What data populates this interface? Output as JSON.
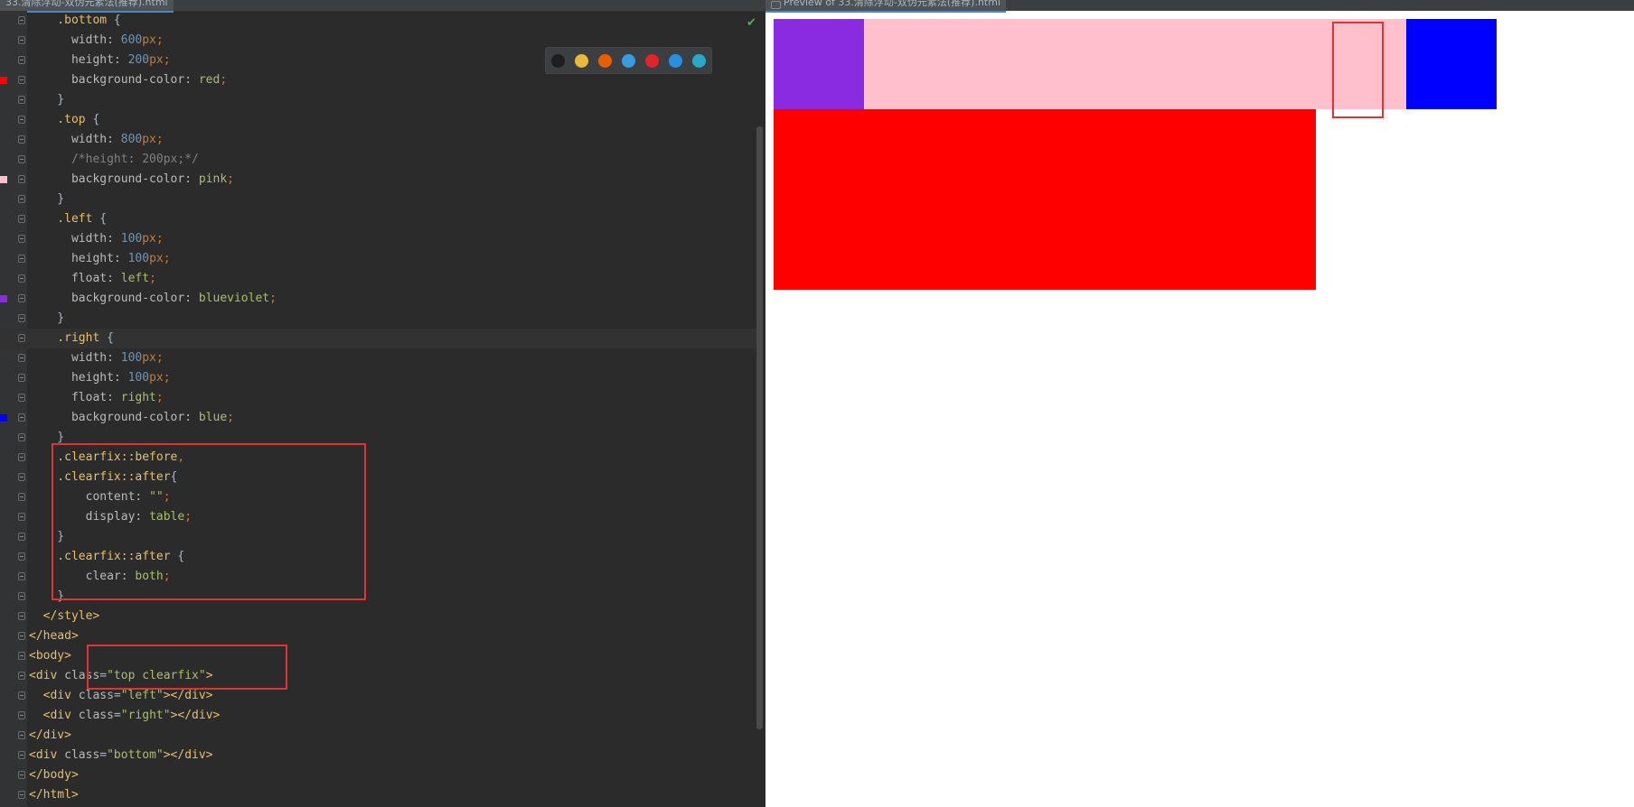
{
  "editor": {
    "tab_label": "33.清除浮动-双伪元素法(推荐).html",
    "lines": [
      {
        "gutter_swatch": null,
        "tokens": [
          {
            "c": "t-sel",
            "t": "    .bottom "
          },
          {
            "c": "",
            "t": "{"
          }
        ]
      },
      {
        "gutter_swatch": null,
        "tokens": [
          {
            "c": "t-prop",
            "t": "      width"
          },
          {
            "c": "",
            "t": ": "
          },
          {
            "c": "t-num",
            "t": "600"
          },
          {
            "c": "t-unit",
            "t": "px"
          },
          {
            "c": "t-punc",
            "t": ";"
          }
        ]
      },
      {
        "gutter_swatch": null,
        "tokens": [
          {
            "c": "t-prop",
            "t": "      height"
          },
          {
            "c": "",
            "t": ": "
          },
          {
            "c": "t-num",
            "t": "200"
          },
          {
            "c": "t-unit",
            "t": "px"
          },
          {
            "c": "t-punc",
            "t": ";"
          }
        ]
      },
      {
        "gutter_swatch": "#ff0000",
        "tokens": [
          {
            "c": "t-prop",
            "t": "      background-color"
          },
          {
            "c": "",
            "t": ": "
          },
          {
            "c": "t-val",
            "t": "red"
          },
          {
            "c": "t-punc",
            "t": ";"
          }
        ]
      },
      {
        "gutter_swatch": null,
        "tokens": [
          {
            "c": "",
            "t": "    }"
          }
        ]
      },
      {
        "gutter_swatch": null,
        "tokens": [
          {
            "c": "t-sel",
            "t": "    .top "
          },
          {
            "c": "",
            "t": "{"
          }
        ]
      },
      {
        "gutter_swatch": null,
        "tokens": [
          {
            "c": "t-prop",
            "t": "      width"
          },
          {
            "c": "",
            "t": ": "
          },
          {
            "c": "t-num",
            "t": "800"
          },
          {
            "c": "t-unit",
            "t": "px"
          },
          {
            "c": "t-punc",
            "t": ";"
          }
        ]
      },
      {
        "gutter_swatch": null,
        "tokens": [
          {
            "c": "t-cmt",
            "t": "      /*height: 200px;*/"
          }
        ]
      },
      {
        "gutter_swatch": "#ffc0cb",
        "tokens": [
          {
            "c": "t-prop",
            "t": "      background-color"
          },
          {
            "c": "",
            "t": ": "
          },
          {
            "c": "t-val",
            "t": "pink"
          },
          {
            "c": "t-punc",
            "t": ";"
          }
        ]
      },
      {
        "gutter_swatch": null,
        "tokens": [
          {
            "c": "",
            "t": "    }"
          }
        ]
      },
      {
        "gutter_swatch": null,
        "tokens": [
          {
            "c": "t-sel",
            "t": "    .left "
          },
          {
            "c": "",
            "t": "{"
          }
        ]
      },
      {
        "gutter_swatch": null,
        "tokens": [
          {
            "c": "t-prop",
            "t": "      width"
          },
          {
            "c": "",
            "t": ": "
          },
          {
            "c": "t-num",
            "t": "100"
          },
          {
            "c": "t-unit",
            "t": "px"
          },
          {
            "c": "t-punc",
            "t": ";"
          }
        ]
      },
      {
        "gutter_swatch": null,
        "tokens": [
          {
            "c": "t-prop",
            "t": "      height"
          },
          {
            "c": "",
            "t": ": "
          },
          {
            "c": "t-num",
            "t": "100"
          },
          {
            "c": "t-unit",
            "t": "px"
          },
          {
            "c": "t-punc",
            "t": ";"
          }
        ]
      },
      {
        "gutter_swatch": null,
        "tokens": [
          {
            "c": "t-prop",
            "t": "      float"
          },
          {
            "c": "",
            "t": ": "
          },
          {
            "c": "t-val",
            "t": "left"
          },
          {
            "c": "t-punc",
            "t": ";"
          }
        ]
      },
      {
        "gutter_swatch": "#8a2be2",
        "tokens": [
          {
            "c": "t-prop",
            "t": "      background-color"
          },
          {
            "c": "",
            "t": ": "
          },
          {
            "c": "t-val",
            "t": "blueviolet"
          },
          {
            "c": "t-punc",
            "t": ";"
          }
        ]
      },
      {
        "gutter_swatch": null,
        "tokens": [
          {
            "c": "",
            "t": "    }"
          }
        ]
      },
      {
        "gutter_swatch": null,
        "caret": true,
        "tokens": [
          {
            "c": "t-sel",
            "t": "    .right "
          },
          {
            "c": "",
            "t": "{"
          }
        ]
      },
      {
        "gutter_swatch": null,
        "tokens": [
          {
            "c": "t-prop",
            "t": "      width"
          },
          {
            "c": "",
            "t": ": "
          },
          {
            "c": "t-num",
            "t": "100"
          },
          {
            "c": "t-unit",
            "t": "px"
          },
          {
            "c": "t-punc",
            "t": ";"
          }
        ]
      },
      {
        "gutter_swatch": null,
        "tokens": [
          {
            "c": "t-prop",
            "t": "      height"
          },
          {
            "c": "",
            "t": ": "
          },
          {
            "c": "t-num",
            "t": "100"
          },
          {
            "c": "t-unit",
            "t": "px"
          },
          {
            "c": "t-punc",
            "t": ";"
          }
        ]
      },
      {
        "gutter_swatch": null,
        "tokens": [
          {
            "c": "t-prop",
            "t": "      float"
          },
          {
            "c": "",
            "t": ": "
          },
          {
            "c": "t-val",
            "t": "right"
          },
          {
            "c": "t-punc",
            "t": ";"
          }
        ]
      },
      {
        "gutter_swatch": "#0000ff",
        "tokens": [
          {
            "c": "t-prop",
            "t": "      background-color"
          },
          {
            "c": "",
            "t": ": "
          },
          {
            "c": "t-val",
            "t": "blue"
          },
          {
            "c": "t-punc",
            "t": ";"
          }
        ]
      },
      {
        "gutter_swatch": null,
        "tokens": [
          {
            "c": "",
            "t": "    }"
          }
        ]
      },
      {
        "gutter_swatch": null,
        "tokens": [
          {
            "c": "t-sel",
            "t": "    .clearfix::before"
          },
          {
            "c": "t-punc",
            "t": ","
          }
        ]
      },
      {
        "gutter_swatch": null,
        "tokens": [
          {
            "c": "t-sel",
            "t": "    .clearfix::after"
          },
          {
            "c": "",
            "t": "{"
          }
        ]
      },
      {
        "gutter_swatch": null,
        "tokens": [
          {
            "c": "t-prop",
            "t": "        content"
          },
          {
            "c": "",
            "t": ": "
          },
          {
            "c": "t-str",
            "t": "\"\""
          },
          {
            "c": "t-punc",
            "t": ";"
          }
        ]
      },
      {
        "gutter_swatch": null,
        "tokens": [
          {
            "c": "t-prop",
            "t": "        display"
          },
          {
            "c": "",
            "t": ": "
          },
          {
            "c": "t-val",
            "t": "table"
          },
          {
            "c": "t-punc",
            "t": ";"
          }
        ]
      },
      {
        "gutter_swatch": null,
        "tokens": [
          {
            "c": "",
            "t": "    }"
          }
        ]
      },
      {
        "gutter_swatch": null,
        "tokens": [
          {
            "c": "t-sel",
            "t": "    .clearfix::after "
          },
          {
            "c": "",
            "t": "{"
          }
        ]
      },
      {
        "gutter_swatch": null,
        "tokens": [
          {
            "c": "t-prop",
            "t": "        clear"
          },
          {
            "c": "",
            "t": ": "
          },
          {
            "c": "t-val",
            "t": "both"
          },
          {
            "c": "t-punc",
            "t": ";"
          }
        ]
      },
      {
        "gutter_swatch": null,
        "tokens": [
          {
            "c": "",
            "t": "    }"
          }
        ]
      },
      {
        "gutter_swatch": null,
        "tokens": [
          {
            "c": "t-tag",
            "t": "  </style>"
          }
        ]
      },
      {
        "gutter_swatch": null,
        "tokens": [
          {
            "c": "t-tag",
            "t": "</head>"
          }
        ]
      },
      {
        "gutter_swatch": null,
        "tokens": [
          {
            "c": "t-tag",
            "t": "<body>"
          }
        ]
      },
      {
        "gutter_swatch": null,
        "tokens": [
          {
            "c": "t-tag",
            "t": "<div "
          },
          {
            "c": "t-attr",
            "t": "class"
          },
          {
            "c": "",
            "t": "="
          },
          {
            "c": "t-str",
            "t": "\"top clearfix\""
          },
          {
            "c": "t-tag",
            "t": ">"
          }
        ]
      },
      {
        "gutter_swatch": null,
        "tokens": [
          {
            "c": "t-tag",
            "t": "  <div "
          },
          {
            "c": "t-attr",
            "t": "class"
          },
          {
            "c": "",
            "t": "="
          },
          {
            "c": "t-str",
            "t": "\"left\""
          },
          {
            "c": "t-tag",
            "t": "></div>"
          }
        ]
      },
      {
        "gutter_swatch": null,
        "tokens": [
          {
            "c": "t-tag",
            "t": "  <div "
          },
          {
            "c": "t-attr",
            "t": "class"
          },
          {
            "c": "",
            "t": "="
          },
          {
            "c": "t-str",
            "t": "\"right\""
          },
          {
            "c": "t-tag",
            "t": "></div>"
          }
        ]
      },
      {
        "gutter_swatch": null,
        "tokens": [
          {
            "c": "t-tag",
            "t": "</div>"
          }
        ]
      },
      {
        "gutter_swatch": null,
        "tokens": [
          {
            "c": "t-tag",
            "t": "<div "
          },
          {
            "c": "t-attr",
            "t": "class"
          },
          {
            "c": "",
            "t": "="
          },
          {
            "c": "t-str",
            "t": "\"bottom\""
          },
          {
            "c": "t-tag",
            "t": "></div>"
          }
        ]
      },
      {
        "gutter_swatch": null,
        "tokens": [
          {
            "c": "t-tag",
            "t": "</body>"
          }
        ]
      },
      {
        "gutter_swatch": null,
        "tokens": [
          {
            "c": "t-tag",
            "t": "</html>"
          }
        ]
      }
    ],
    "browser_icons": [
      {
        "name": "intellij-icon",
        "color": "#1e1e1e"
      },
      {
        "name": "chrome-icon",
        "color": "#e8b93a"
      },
      {
        "name": "firefox-icon",
        "color": "#e66000"
      },
      {
        "name": "safari-icon",
        "color": "#3b9be0"
      },
      {
        "name": "opera-icon",
        "color": "#e0242c"
      },
      {
        "name": "internet-explorer-icon",
        "color": "#2b8fe0"
      },
      {
        "name": "edge-icon",
        "color": "#2aa8c8"
      }
    ]
  },
  "preview": {
    "tab_label": "Preview of 33.清除浮动-双伪元素法(推荐).html",
    "colors": {
      "top": "#ffc0cb",
      "left": "#8a2be2",
      "right": "#0000ff",
      "bottom": "#ff0000"
    }
  }
}
